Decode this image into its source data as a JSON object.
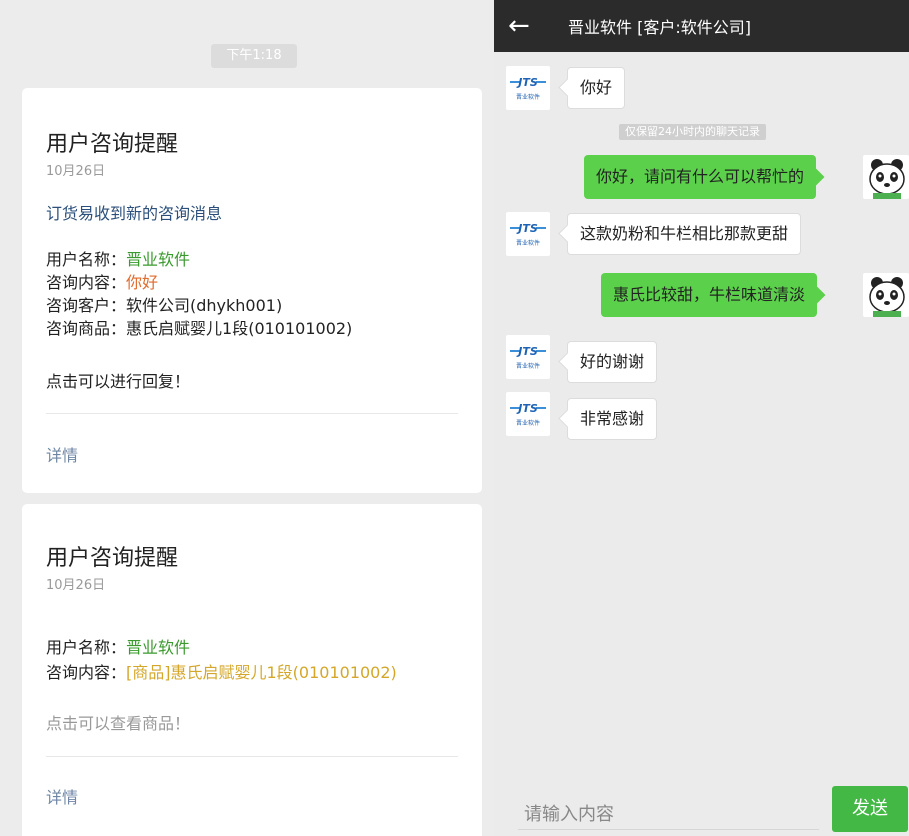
{
  "left": {
    "timestamp": "下午1:18",
    "card1": {
      "title": "用户咨询提醒",
      "date": "10月26日",
      "subtitle": "订货易收到新的咨询消息",
      "user_label": "用户名称：",
      "user_value": "晋业软件",
      "content_label": "咨询内容：",
      "content_value": "你好",
      "customer_label": "咨询客户：",
      "customer_value": "软件公司(dhykh001)",
      "product_label": "咨询商品：",
      "product_value": "惠氏启赋婴儿1段(010101002)",
      "action": "点击可以进行回复！",
      "detail": "详情"
    },
    "card2": {
      "title": "用户咨询提醒",
      "date": "10月26日",
      "user_label": "用户名称：",
      "user_value": "晋业软件",
      "content_label": "咨询内容：",
      "content_value": "[商品]惠氏启赋婴儿1段(010101002)",
      "action": "点击可以查看商品！",
      "detail": "详情"
    }
  },
  "right": {
    "back_icon": "←",
    "title": "晋业软件 [客户:软件公司]",
    "notice": "仅保留24小时内的聊天记录",
    "avatar_text": "JTS",
    "avatar_subtext": "晋业软件",
    "messages": [
      {
        "from": "in",
        "text": "你好"
      },
      {
        "from": "out",
        "text": "你好，请问有什么可以帮忙的"
      },
      {
        "from": "in",
        "text": "这款奶粉和牛栏相比那款更甜"
      },
      {
        "from": "out",
        "text": "惠氏比较甜，牛栏味道清淡"
      },
      {
        "from": "in",
        "text": "好的谢谢"
      },
      {
        "from": "in",
        "text": "非常感谢"
      }
    ],
    "input_placeholder": "请输入内容",
    "send_label": "发送"
  },
  "colors": {
    "accent_green": "#3a9a2e",
    "send_green": "#43b845",
    "bubble_green": "#5bd04a",
    "topbar": "#2b2b2b"
  },
  "icons": {
    "back": "back-arrow-icon",
    "company_avatar": "jts-logo-icon",
    "user_avatar": "panda-icon"
  }
}
